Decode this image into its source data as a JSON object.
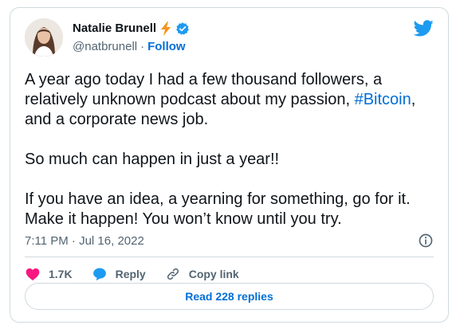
{
  "author": {
    "name": "Natalie Brunell",
    "handle": "@natbrunell",
    "separator": "·",
    "follow_label": "Follow",
    "badges": [
      "lightning-bolt-icon",
      "verified-badge-icon"
    ]
  },
  "tweet": {
    "text_before": "A year ago today I had a few thousand followers, a relatively unknown podcast about my passion, ",
    "hashtag": "#Bitcoin",
    "text_after": ", and a corporate news job.\n\nSo much can happen in just a year!!\n\nIf you have an idea, a yearning for something, go for it. Make it happen! You won’t know until you try."
  },
  "meta": {
    "timestamp": "7:11 PM · Jul 16, 2022"
  },
  "actions": {
    "likes": "1.7K",
    "reply_label": "Reply",
    "copy_link_label": "Copy link"
  },
  "replies_button": "Read 228 replies",
  "colors": {
    "accent": "#006fd6",
    "like": "#f91880",
    "twitter_blue": "#1d9bf0",
    "bolt": "#f7931a"
  }
}
